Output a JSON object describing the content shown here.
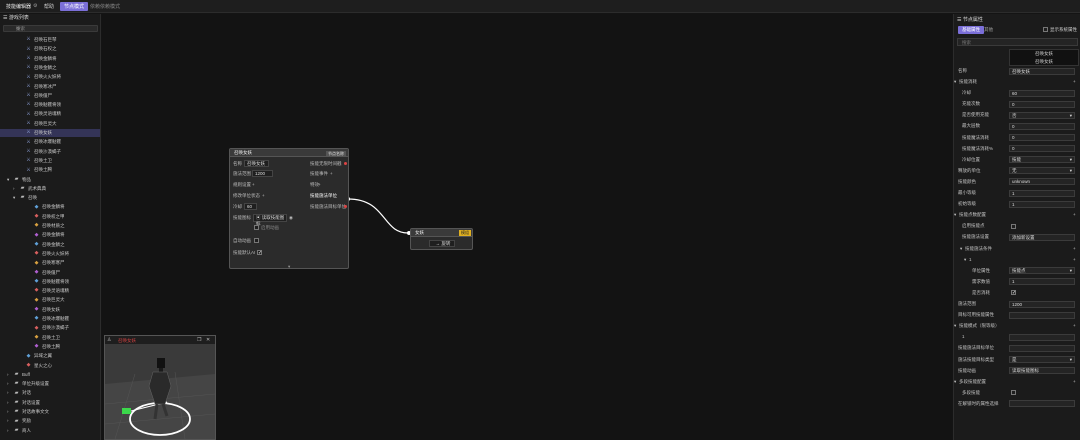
{
  "topbar": {
    "title": "技能编辑器",
    "tabs": [
      "帮助",
      "节点模式",
      "依赖依赖模式"
    ],
    "active_tab": "节点模式"
  },
  "left_panel": {
    "title": "游戏列表",
    "search_placeholder": "搜索",
    "items": [
      {
        "label": "召唤石巨琴",
        "indent": 26,
        "icon": "summon-icon"
      },
      {
        "label": "召唤石权之",
        "indent": 26,
        "icon": "summon-icon"
      },
      {
        "label": "召唤金鳞将",
        "indent": 26,
        "icon": "summon-icon"
      },
      {
        "label": "召唤金鳞之",
        "indent": 26,
        "icon": "summon-icon"
      },
      {
        "label": "召唤火火妖将",
        "indent": 26,
        "icon": "summon-icon"
      },
      {
        "label": "召唤寒冰尸",
        "indent": 26,
        "icon": "summon-icon"
      },
      {
        "label": "召唤僵尸",
        "indent": 26,
        "icon": "summon-icon"
      },
      {
        "label": "召唤骷髅将领",
        "indent": 26,
        "icon": "summon-icon"
      },
      {
        "label": "召唤灵语魂精",
        "indent": 26,
        "icon": "summon-icon"
      },
      {
        "label": "召唤巨灵大",
        "indent": 26,
        "icon": "summon-icon"
      },
      {
        "label": "召唤女妖",
        "indent": 26,
        "icon": "summon-icon",
        "selected": true
      },
      {
        "label": "召唤冰爆骷髅",
        "indent": 26,
        "icon": "summon-icon"
      },
      {
        "label": "召唤沙漠蝎子",
        "indent": 26,
        "icon": "summon-icon"
      },
      {
        "label": "召唤土卫",
        "indent": 26,
        "icon": "summon-icon"
      },
      {
        "label": "召唤土腾",
        "indent": 26,
        "icon": "summon-icon"
      },
      {
        "label": "物品",
        "indent": 14,
        "icon": "folder-icon",
        "arrow": "▾"
      },
      {
        "label": "武术典典",
        "indent": 20,
        "icon": "folder-icon",
        "arrow": "›"
      },
      {
        "label": "召唤",
        "indent": 20,
        "icon": "folder-icon",
        "arrow": "▾"
      },
      {
        "label": "召唤金鳞将",
        "indent": 34,
        "icon": "item-icon"
      },
      {
        "label": "召唤权之甲",
        "indent": 34,
        "icon": "item-icon"
      },
      {
        "label": "召唤材质之",
        "indent": 34,
        "icon": "item-icon"
      },
      {
        "label": "召唤金鳞将",
        "indent": 34,
        "icon": "item-icon"
      },
      {
        "label": "召唤金鳞之",
        "indent": 34,
        "icon": "item-icon"
      },
      {
        "label": "召唤火火妖将",
        "indent": 34,
        "icon": "item-icon"
      },
      {
        "label": "召唤寒寒尸",
        "indent": 34,
        "icon": "item-icon"
      },
      {
        "label": "召唤僵尸",
        "indent": 34,
        "icon": "item-icon"
      },
      {
        "label": "召唤骷髅将领",
        "indent": 34,
        "icon": "item-icon"
      },
      {
        "label": "召唤灵语魂精",
        "indent": 34,
        "icon": "item-icon"
      },
      {
        "label": "召唤巨灵大",
        "indent": 34,
        "icon": "item-icon"
      },
      {
        "label": "召唤女妖",
        "indent": 34,
        "icon": "item-icon"
      },
      {
        "label": "召唤冰爆骷髅",
        "indent": 34,
        "icon": "item-icon"
      },
      {
        "label": "召唤沙漠蝎子",
        "indent": 34,
        "icon": "item-icon"
      },
      {
        "label": "召唤土卫",
        "indent": 34,
        "icon": "item-icon"
      },
      {
        "label": "召唤土腾",
        "indent": 34,
        "icon": "item-icon"
      },
      {
        "label": "异域之翼",
        "indent": 26,
        "icon": "item-icon"
      },
      {
        "label": "星火之心",
        "indent": 26,
        "icon": "item-icon"
      },
      {
        "label": "Buff",
        "indent": 14,
        "icon": "folder-icon",
        "arrow": "›"
      },
      {
        "label": "单位升级设置",
        "indent": 14,
        "icon": "folder-icon",
        "arrow": "›"
      },
      {
        "label": "对话",
        "indent": 14,
        "icon": "folder-icon",
        "arrow": "›"
      },
      {
        "label": "对话设置",
        "indent": 14,
        "icon": "folder-icon",
        "arrow": "›"
      },
      {
        "label": "对话故事文文",
        "indent": 14,
        "icon": "folder-icon",
        "arrow": "›"
      },
      {
        "label": "奖励",
        "indent": 14,
        "icon": "folder-icon",
        "arrow": "›"
      },
      {
        "label": "商人",
        "indent": 14,
        "icon": "folder-icon",
        "arrow": "›"
      }
    ]
  },
  "node_main": {
    "title": "召唤女妖",
    "tag": "节点名称",
    "fields": {
      "name_label": "名称",
      "name_value": "召唤女妖",
      "range_label": "施法范围",
      "range_value": "1200",
      "extra_label": "规则设置",
      "target_label": "修改单位状态",
      "cooldown_label": "冷却",
      "cooldown_value": "60",
      "icon_label": "技能图标",
      "icon_value": "读取技能图标",
      "icon_check": "启用动画",
      "auto_label": "自动动画",
      "default_label": "技能默认AI"
    },
    "right_fields": [
      "技能无限时间戳",
      "技能事件",
      "特效",
      "技能施法单位",
      "技能施法目标单位"
    ]
  },
  "node_target": {
    "title": "女妖",
    "tag": "模组",
    "button": "→ 旋转"
  },
  "preview": {
    "title": "召唤女妖",
    "icons": [
      "copy-icon",
      "close-icon"
    ]
  },
  "right_panel": {
    "title": "节点属性",
    "tabs": [
      "基础属性",
      "其他"
    ],
    "show_all_label": "显示系统属性",
    "search_placeholder": "搜索",
    "name_label": "名称",
    "name_value": "召唤女妖",
    "preview_labels": [
      "召唤女妖",
      "召唤女妖"
    ],
    "sections": [
      {
        "label": "技能消耗",
        "section": true
      },
      {
        "label": "冷却",
        "value": "60",
        "indent": 4
      },
      {
        "label": "充能次数",
        "value": "0",
        "indent": 4
      },
      {
        "label": "是否使用充能",
        "value": "否",
        "indent": 4,
        "dropdown": true
      },
      {
        "label": "最大层数",
        "value": "0",
        "indent": 4
      },
      {
        "label": "技能魔法消耗",
        "value": "0",
        "indent": 4
      },
      {
        "label": "技能魔法消耗%",
        "value": "0",
        "indent": 4
      },
      {
        "label": "冷却位置",
        "value": "技能",
        "indent": 4,
        "dropdown": true
      },
      {
        "label": "释放的单位",
        "value": "无",
        "indent": 0,
        "dropdown": true
      },
      {
        "label": "技能颜色",
        "value": "unknown",
        "indent": 0
      },
      {
        "label": "最小等级",
        "value": "1",
        "indent": 0
      },
      {
        "label": "初始等级",
        "value": "1",
        "indent": 0
      },
      {
        "label": "技能点数配置",
        "section": true
      },
      {
        "label": "启用技能点",
        "value": "",
        "indent": 4,
        "check": true
      },
      {
        "label": "技能施法设置",
        "value": "添加新设置",
        "indent": 4
      },
      {
        "label": "技能施法条件",
        "section": true,
        "indent": 6
      },
      {
        "label": "1",
        "section": true,
        "indent": 10
      },
      {
        "label": "单位属性",
        "value": "技能点",
        "indent": 14,
        "dropdown": true
      },
      {
        "label": "需求数值",
        "value": "1",
        "indent": 14
      },
      {
        "label": "是否消耗",
        "value": "✓",
        "indent": 14,
        "check": true
      },
      {
        "label": "施法范围",
        "value": "1200",
        "indent": 0
      },
      {
        "label": "目标可用技能属性",
        "value": "",
        "indent": 0
      },
      {
        "label": "技能模式（限等级）",
        "section": true
      },
      {
        "label": "1",
        "value": "",
        "indent": 4
      },
      {
        "label": "技能施法目标单位",
        "value": "",
        "indent": 0
      },
      {
        "label": "施法技能目标类型",
        "value": "是",
        "indent": 0,
        "dropdown": true
      },
      {
        "label": "技能动画",
        "value": "读取技能图标",
        "indent": 0
      },
      {
        "label": "多段技能配置",
        "section": true
      },
      {
        "label": "多段技能",
        "value": "",
        "indent": 4,
        "check": true
      },
      {
        "label": "在解锁时的属性选择",
        "value": "",
        "indent": 0
      }
    ]
  }
}
